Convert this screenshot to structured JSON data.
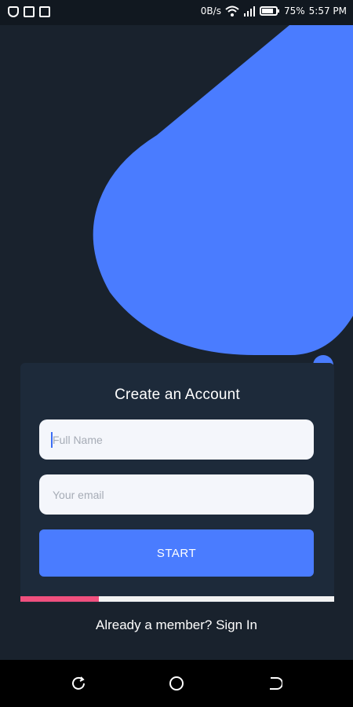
{
  "status_bar": {
    "icons": [
      "shield-icon",
      "cast-icon",
      "activity-icon"
    ],
    "net_speed": "0B/s",
    "battery": "75%",
    "time": "5:57 PM"
  },
  "colors": {
    "background": "#19222d",
    "card": "#1d2a3a",
    "accent": "#4a7cff",
    "progress": "#f0507e"
  },
  "form": {
    "title": "Create an Account",
    "name_placeholder": "Full Name",
    "email_placeholder": "Your email",
    "start_label": "START",
    "progress": 0.25
  },
  "footer": {
    "signin_text": "Already a member? Sign In"
  },
  "nav": {
    "buttons": [
      "recent-apps",
      "home",
      "back"
    ]
  }
}
